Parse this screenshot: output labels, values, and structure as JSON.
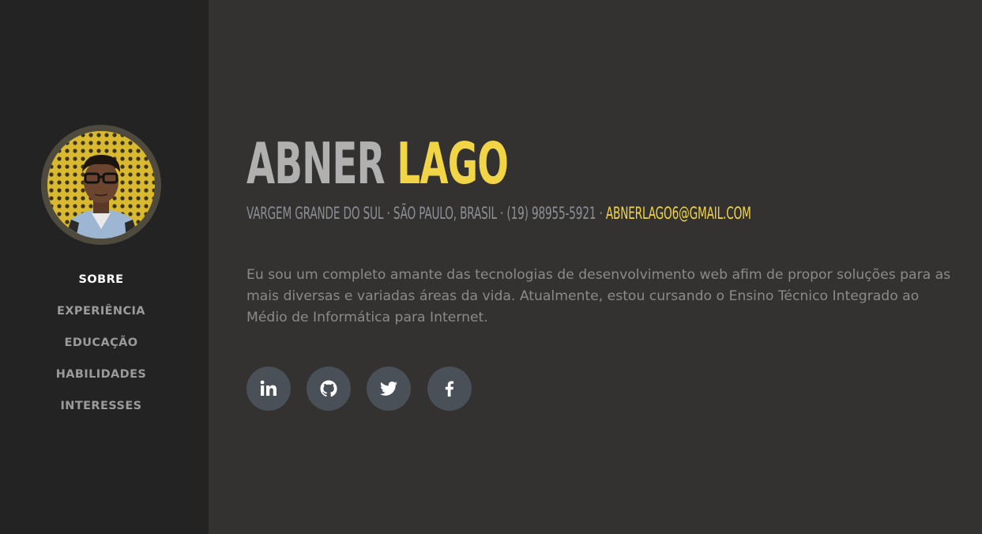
{
  "sidebar": {
    "avatar": "profile-photo",
    "nav": [
      {
        "label": "SOBRE",
        "active": true
      },
      {
        "label": "EXPERIÊNCIA",
        "active": false
      },
      {
        "label": "EDUCAÇÃO",
        "active": false
      },
      {
        "label": "HABILIDADES",
        "active": false
      },
      {
        "label": "INTERESSES",
        "active": false
      }
    ]
  },
  "main": {
    "first_name": "ABNER",
    "last_name": "LAGO",
    "address": "VARGEM GRANDE DO SUL · SÃO PAULO, BRASIL · (19) 98955-5921 · ",
    "email": "ABNERLAGO6@GMAIL.COM",
    "bio": "Eu sou um completo amante das tecnologias de desenvolvimento web afim de propor soluções para as mais diversas e variadas áreas da vida. Atualmente, estou cursando o Ensino Técnico Integrado ao Médio de Informática para Internet.",
    "socials": [
      {
        "icon": "linkedin-icon"
      },
      {
        "icon": "github-icon"
      },
      {
        "icon": "twitter-icon"
      },
      {
        "icon": "facebook-icon"
      }
    ]
  },
  "colors": {
    "accent": "#f2d546",
    "sidebar_bg": "#232323",
    "main_bg": "#333230",
    "social_bg": "#495057"
  }
}
